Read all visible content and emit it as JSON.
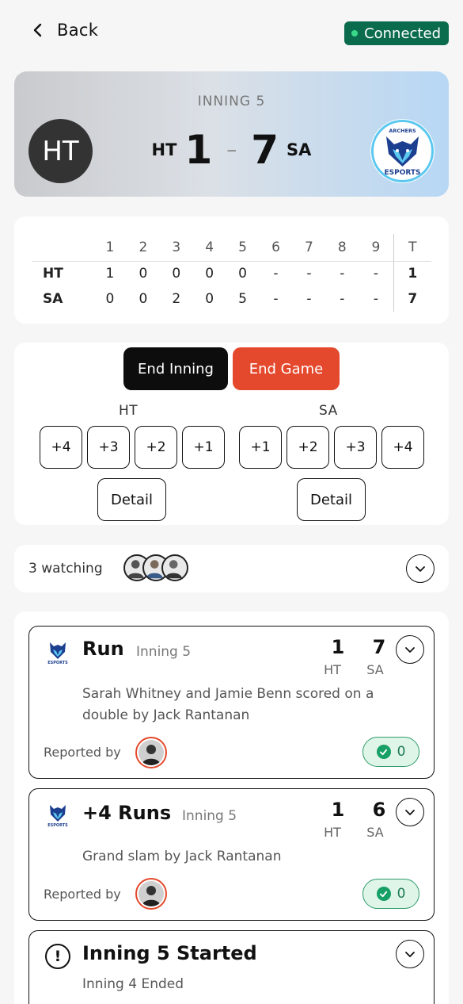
{
  "header": {
    "back_label": "Back",
    "status_label": "Connected"
  },
  "colors": {
    "connected_bg": "#0b6b4d",
    "end_game_bg": "#e5492d",
    "end_inning_bg": "#0d0d0d",
    "ack_green": "#17a066"
  },
  "game": {
    "inning_label": "INNING 5",
    "home": {
      "abbr": "HT",
      "score": "1",
      "avatar_text": "HT"
    },
    "away": {
      "abbr": "SA",
      "score": "7"
    },
    "separator": "–"
  },
  "linescore": {
    "columns": [
      "1",
      "2",
      "3",
      "4",
      "5",
      "6",
      "7",
      "8",
      "9",
      "T"
    ],
    "rows": [
      {
        "team": "HT",
        "cells": [
          "1",
          "0",
          "0",
          "0",
          "0",
          "-",
          "-",
          "-",
          "-",
          "1"
        ]
      },
      {
        "team": "SA",
        "cells": [
          "0",
          "0",
          "2",
          "0",
          "5",
          "-",
          "-",
          "-",
          "-",
          "7"
        ]
      }
    ]
  },
  "controls": {
    "end_inning": "End Inning",
    "end_game": "End Game",
    "home_label": "HT",
    "away_label": "SA",
    "home_increments": [
      "+4",
      "+3",
      "+2",
      "+1"
    ],
    "away_increments": [
      "+1",
      "+2",
      "+3",
      "+4"
    ],
    "detail_label": "Detail"
  },
  "watching": {
    "text": "3 watching",
    "avatar_icons": [
      "user-avatar-icon",
      "user-avatar-icon",
      "user-avatar-icon"
    ]
  },
  "feed": [
    {
      "title": "Run",
      "inning": "Inning 5",
      "home_score": "1",
      "away_score": "7",
      "home_abbr": "HT",
      "away_abbr": "SA",
      "description": "Sarah Whitney and Jamie Benn scored on a double by Jack Rantanan",
      "reported_by": "Reported by",
      "ack_count": "0"
    },
    {
      "title": "+4 Runs",
      "inning": "Inning 5",
      "home_score": "1",
      "away_score": "6",
      "home_abbr": "HT",
      "away_abbr": "SA",
      "description": "Grand slam by Jack Rantanan",
      "reported_by": "Reported by",
      "ack_count": "0"
    },
    {
      "title": "Inning 5 Started",
      "description": "Inning 4 Ended"
    }
  ]
}
